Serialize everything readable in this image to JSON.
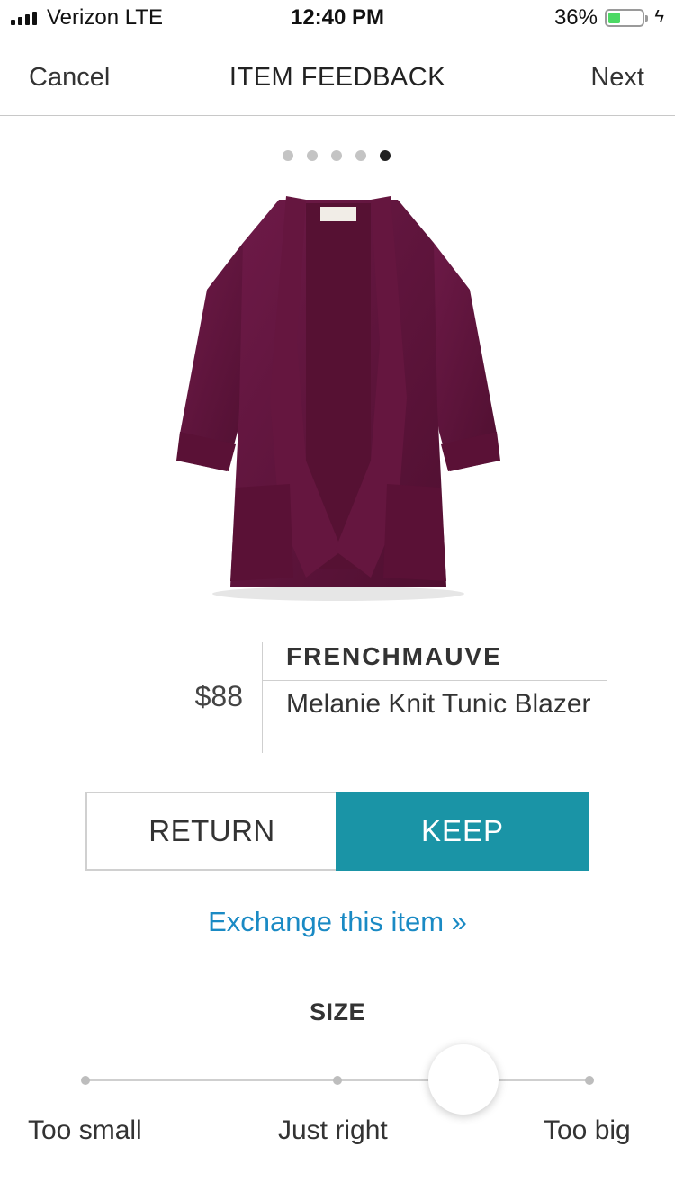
{
  "status_bar": {
    "carrier": "Verizon  LTE",
    "time": "12:40 PM",
    "battery_percent": "36%",
    "battery_level": 0.36,
    "battery_color": "#4cd964"
  },
  "nav": {
    "cancel_label": "Cancel",
    "title": "ITEM FEEDBACK",
    "next_label": "Next"
  },
  "pager": {
    "total": 5,
    "current": 5
  },
  "product": {
    "image_icon": "blazer-image",
    "image_color": "#5c1238",
    "price": "$88",
    "brand": "FRENCHMAUVE",
    "name": "Melanie Knit Tunic Blazer"
  },
  "actions": {
    "return_label": "RETURN",
    "keep_label": "KEEP",
    "keep_color": "#1a94a6",
    "exchange_link": "Exchange this item »",
    "link_color": "#1a8ac4"
  },
  "size": {
    "heading": "SIZE",
    "options": [
      "Too small",
      "Just right",
      "Too big"
    ],
    "selected_value": 0.75
  }
}
